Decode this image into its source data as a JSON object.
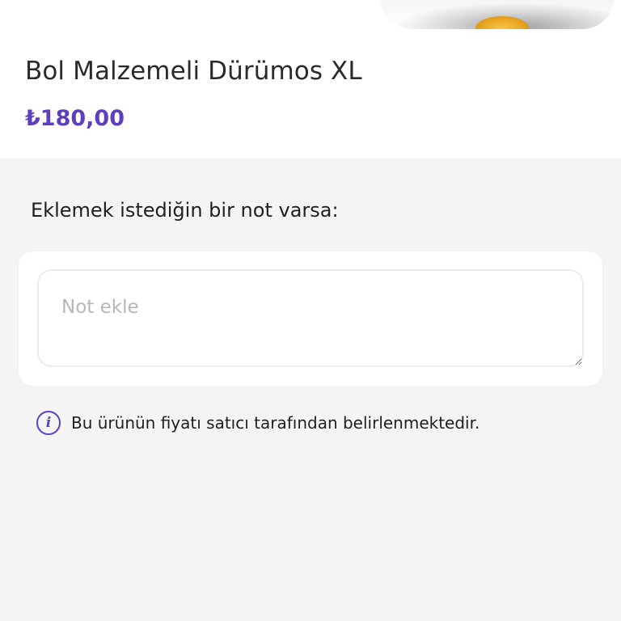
{
  "product": {
    "image_alt": "food-plate-image",
    "title": "Bol Malzemeli Dürümos XL",
    "price": "₺180,00"
  },
  "note": {
    "label": "Eklemek istediğin bir not varsa:",
    "placeholder": "Not ekle",
    "value": ""
  },
  "info": {
    "icon": "info-icon",
    "icon_glyph": "i",
    "text": "Bu ürünün fiyatı satıcı tarafından belirlenmektedir."
  },
  "colors": {
    "accent": "#5d3ebc",
    "background": "#f4f4f4",
    "card": "#ffffff",
    "placeholder": "#b7b7b7"
  }
}
